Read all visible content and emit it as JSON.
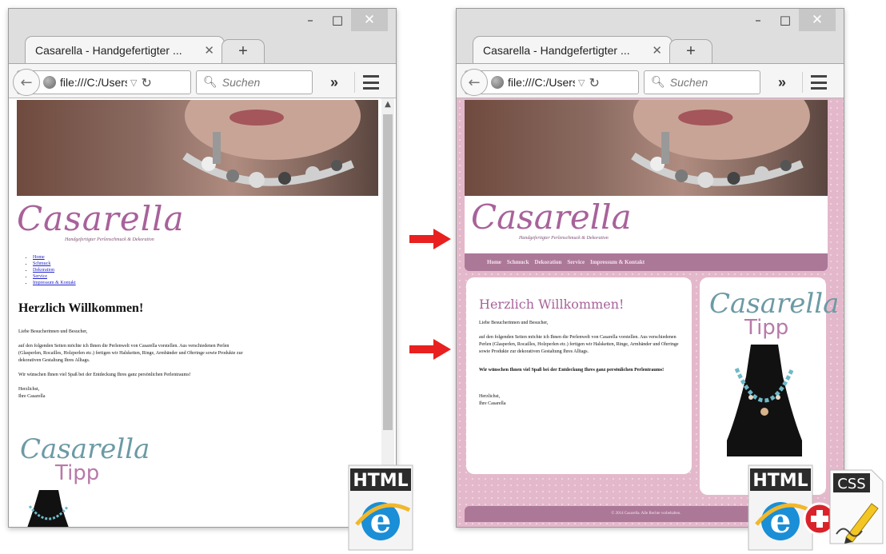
{
  "left_window": {
    "tab_title": "Casarella - Handgefertigter ...",
    "url": "file:///C:/Users,",
    "search_placeholder": "Suchen"
  },
  "right_window": {
    "tab_title": "Casarella - Handgefertigter ...",
    "url": "file:///C:/Users",
    "search_placeholder": "Suchen"
  },
  "site": {
    "logo": "Casarella",
    "tagline": "Handgefertigter Perlenschmuck & Dekoration",
    "nav": [
      "Home",
      "Schmuck",
      "Dekoration",
      "Service",
      "Impressum & Kontakt"
    ],
    "heading": "Herzlich Willkommen!",
    "greeting": "Liebe Besucherinnen und Besucher,",
    "intro": "auf den folgenden Seiten möchte ich Ihnen die Perlenwelt von Casarella vorstellen. Aus verschiedenen Perlen (Glasperlen, Rocailles, Holzperlen etc.) fertigen wir Halsketten, Ringe, Armbänder und Ohrringe sowie Produkte zur dekorativen Gestaltung Ihres Alltags.",
    "wish": "Wir wünschen Ihnen viel Spaß bei der Entdeckung Ihres ganz persönlichen Perlentraums!",
    "closing": "Herzlichst,",
    "signature": "Ihre Casarella",
    "tipp_logo": "Casarella",
    "tipp_word": "Tipp",
    "footer": "© 2014 Casarella. Alle Rechte vorbehalten."
  },
  "badges": {
    "html_label": "HTML",
    "css_label": "CSS"
  },
  "colors": {
    "brand_pink": "#a8629a",
    "nav_mauve": "#ac7898",
    "tipp_teal": "#6c9aa5",
    "arrow_red": "#e8201f"
  }
}
